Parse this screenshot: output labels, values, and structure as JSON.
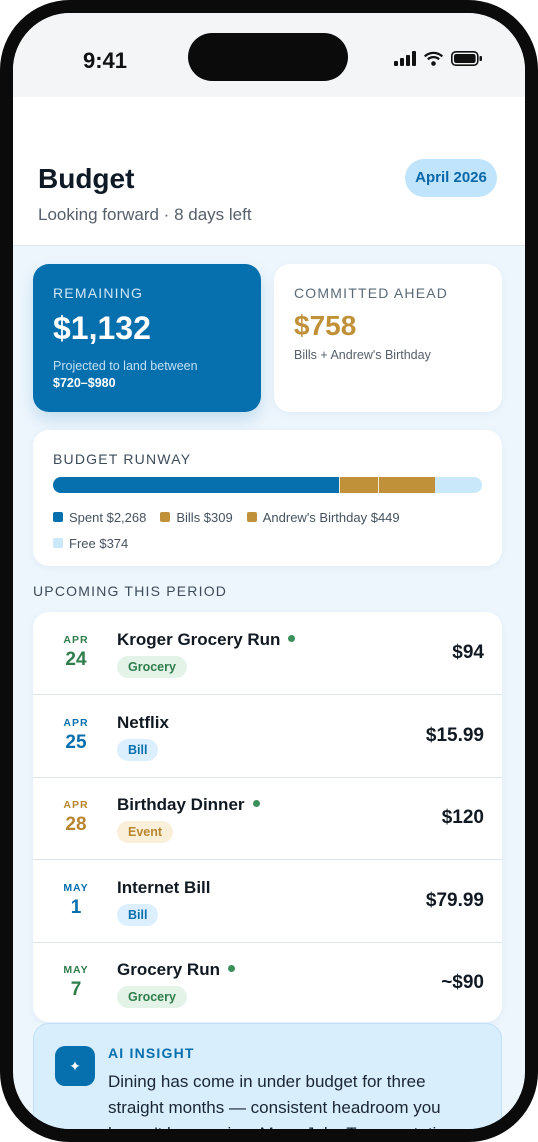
{
  "status_bar": {
    "time": "9:41",
    "icons": [
      "signal-icon",
      "wifi-icon",
      "battery-icon"
    ]
  },
  "header": {
    "title": "Budget",
    "subtitle": "Looking forward · 8 days left",
    "period": "April 2026"
  },
  "remaining": {
    "label": "REMAINING",
    "amount": "$1,132",
    "projection_text": "Projected to land between",
    "projection_range": "$720–$980"
  },
  "committed": {
    "label": "COMMITTED AHEAD",
    "amount": "$758",
    "note": "Bills + Andrew's Birthday"
  },
  "runway": {
    "label": "BUDGET RUNWAY",
    "segments": [
      {
        "label": "Spent $2,268",
        "value": 2268,
        "color": "#066fad"
      },
      {
        "label": "Bills $309",
        "value": 309,
        "color": "#c1913a"
      },
      {
        "label": "Andrew's Birthday $449",
        "value": 449,
        "color": "#c1913a"
      },
      {
        "label": "Free $374",
        "value": 374,
        "color": "#c9e8fa"
      }
    ]
  },
  "upcoming": {
    "label": "UPCOMING THIS PERIOD",
    "items": [
      {
        "month": "APR",
        "day": "24",
        "name": "Kroger Grocery Run",
        "dot": true,
        "tag": "Grocery",
        "amount": "$94",
        "date_color": "#2f7d4a",
        "tag_color": "#2f7d4a",
        "tag_bg": "#e3f3e8"
      },
      {
        "month": "APR",
        "day": "25",
        "name": "Netflix",
        "dot": false,
        "tag": "Bill",
        "amount": "$15.99",
        "date_color": "#066fad",
        "tag_color": "#066fad",
        "tag_bg": "#dcefff"
      },
      {
        "month": "APR",
        "day": "28",
        "name": "Birthday Dinner",
        "dot": true,
        "tag": "Event",
        "amount": "$120",
        "date_color": "#b8862f",
        "tag_color": "#b8862f",
        "tag_bg": "#faefd9"
      },
      {
        "month": "MAY",
        "day": "1",
        "name": "Internet Bill",
        "dot": false,
        "tag": "Bill",
        "amount": "$79.99",
        "date_color": "#066fad",
        "tag_color": "#066fad",
        "tag_bg": "#dcefff"
      },
      {
        "month": "MAY",
        "day": "7",
        "name": "Grocery Run",
        "dot": true,
        "tag": "Grocery",
        "amount": "~$90",
        "date_color": "#2f7d4a",
        "tag_color": "#2f7d4a",
        "tag_bg": "#e3f3e8"
      }
    ]
  },
  "insight": {
    "label": "AI INSIGHT",
    "icon": "sparkle-icon",
    "text": "Dining has come in under budget for three straight months — consistent headroom you haven't been using. Move Jake Transportation"
  }
}
